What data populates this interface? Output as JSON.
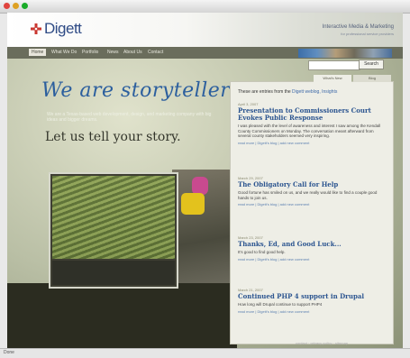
{
  "window": {
    "title": ""
  },
  "header": {
    "logo_text": "Digett",
    "tagline_main": "Interactive Media & Marketing",
    "tagline_sub": "for professional service providers"
  },
  "nav": {
    "items": [
      {
        "label": "Home",
        "active": true
      },
      {
        "label": "What We Do"
      },
      {
        "label": "Portfolio"
      },
      {
        "label": "News"
      },
      {
        "label": "About Us"
      },
      {
        "label": "Contact"
      }
    ]
  },
  "search": {
    "button_label": "Search",
    "placeholder": ""
  },
  "hero": {
    "headline": "We are storytellers",
    "intro": "We are a Texas-based web development, design, and marketing company with big ideas and bigger dreams.",
    "subheadline": "Let us tell your story."
  },
  "sidebar": {
    "tabs": [
      {
        "label": "What's New",
        "active": true
      },
      {
        "label": "Blog"
      }
    ],
    "intro_prefix": "These are entries from the",
    "intro_link": "Digett weblog, Insights",
    "posts": [
      {
        "date": "April 3, 2007",
        "title": "Presentation to Commissioners Court Evokes Public Response",
        "text": "I was pleased with the level of awareness and interest I saw among the Kendall County Commissioners on Monday. The conversation meant afterward from several county stakeholders seemed very inspiring.",
        "links": "read more | Digett's blog | add new comment"
      },
      {
        "date": "March 29, 2007",
        "title": "The Obligatory Call for Help",
        "text": "Good fortune has smiled on us, and we really would like to find a couple good hands to join us.",
        "links": "read more | Digett's blog | add new comment"
      },
      {
        "date": "March 23, 2007",
        "title": "Thanks, Ed, and Good Luck...",
        "text": "It's good to find good help.",
        "links": "read more | Digett's blog | add new comment"
      },
      {
        "date": "March 21, 2007",
        "title": "Continued PHP 4 support in Drupal",
        "text": "How long will Drupal continue to support PHP4",
        "links": "read more | Digett's blog | add new comment"
      }
    ]
  },
  "footer": {
    "links": "contact · privacy policy · sitemap"
  },
  "status": {
    "text": "Done"
  }
}
